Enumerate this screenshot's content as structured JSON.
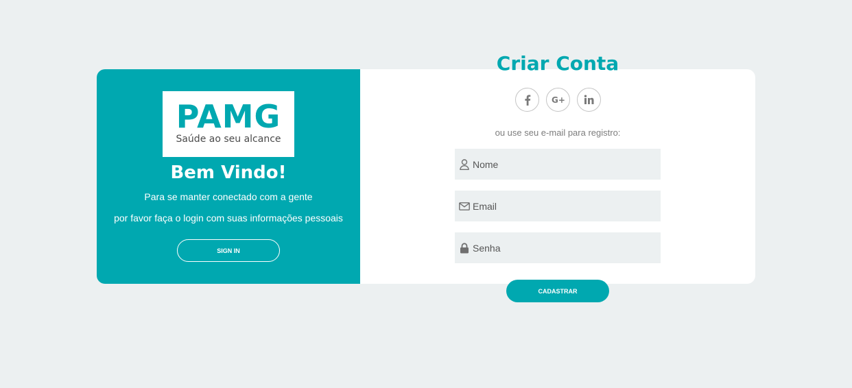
{
  "brand": {
    "logo_text": "PAMG",
    "logo_tagline": "Saúde ao seu alcance",
    "accent_color": "#00a8b0"
  },
  "left_panel": {
    "title": "Bem Vindo!",
    "line1": "Para se manter conectado com a gente",
    "line2": "por favor faça o login com suas informações pessoais",
    "signin_label": "SIGN IN"
  },
  "right_panel": {
    "title": "Criar Conta",
    "social": [
      {
        "icon": "facebook-icon"
      },
      {
        "icon": "google-plus-icon"
      },
      {
        "icon": "linkedin-icon"
      }
    ],
    "email_hint": "ou use seu e-mail para registro:",
    "fields": {
      "name_placeholder": "Nome",
      "email_placeholder": "Email",
      "password_placeholder": "Senha"
    },
    "submit_label": "CADASTRAR"
  }
}
